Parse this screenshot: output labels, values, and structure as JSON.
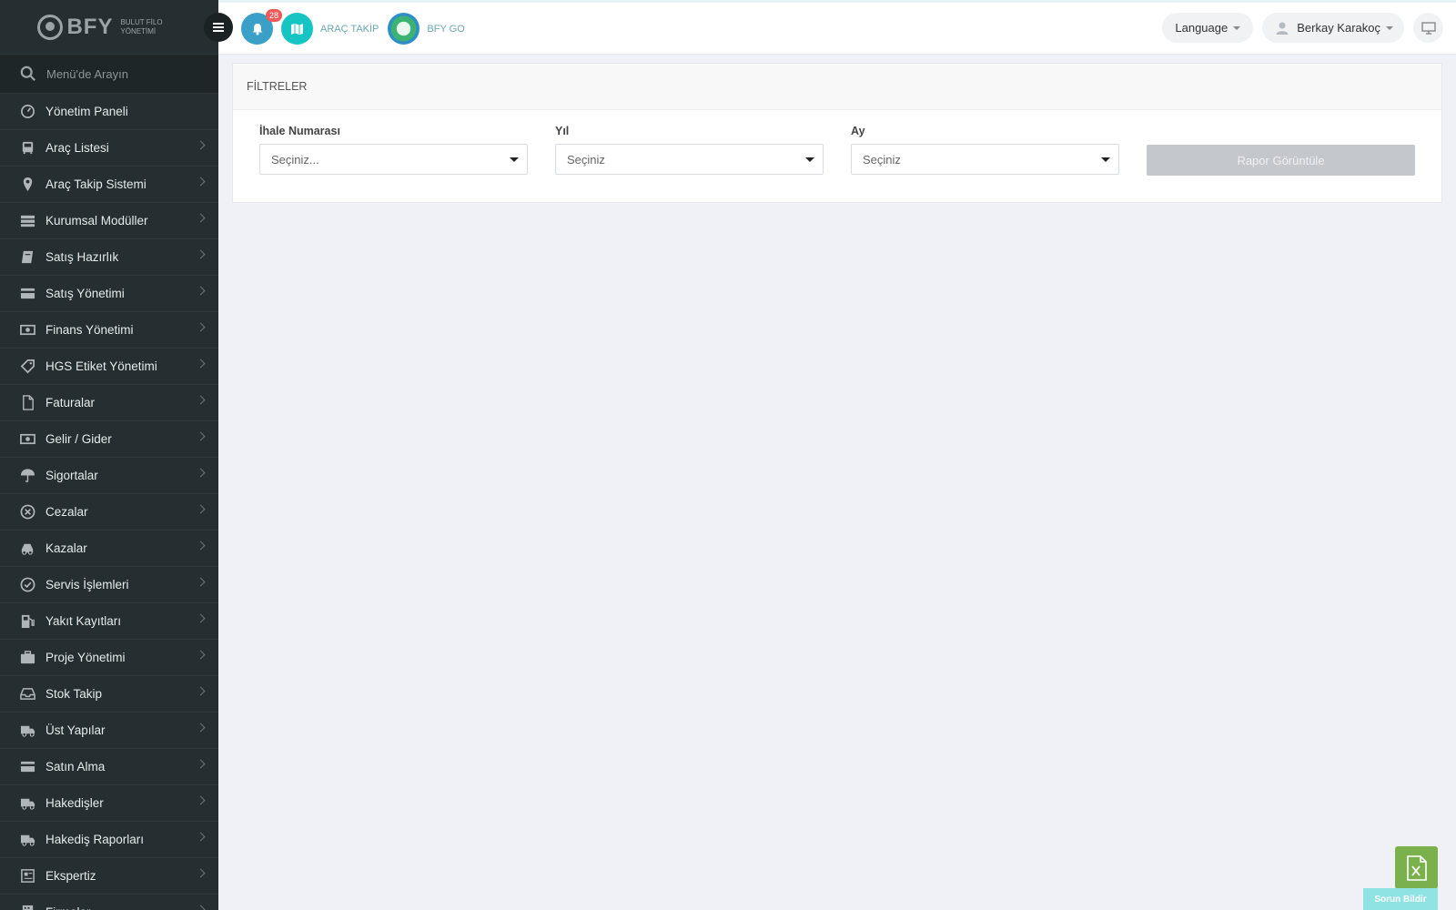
{
  "brand": {
    "name": "BFY",
    "sub_line1": "BULUT FİLO",
    "sub_line2": "YÖNETİMİ"
  },
  "sidebar": {
    "search_placeholder": "Menü'de Arayın",
    "items": [
      {
        "label": "Yönetim Paneli",
        "icon": "dashboard-icon"
      },
      {
        "label": "Araç Listesi",
        "icon": "bus-icon"
      },
      {
        "label": "Araç Takip Sistemi",
        "icon": "map-pin-icon"
      },
      {
        "label": "Kurumsal Modüller",
        "icon": "server-icon"
      },
      {
        "label": "Satış Hazırlık",
        "icon": "book-icon"
      },
      {
        "label": "Satış Yönetimi",
        "icon": "credit-card-icon"
      },
      {
        "label": "Finans Yönetimi",
        "icon": "money-icon"
      },
      {
        "label": "HGS Etiket Yönetimi",
        "icon": "tags-icon"
      },
      {
        "label": "Faturalar",
        "icon": "file-icon"
      },
      {
        "label": "Gelir / Gider",
        "icon": "money-icon"
      },
      {
        "label": "Sigortalar",
        "icon": "umbrella-icon"
      },
      {
        "label": "Cezalar",
        "icon": "times-circle-icon"
      },
      {
        "label": "Kazalar",
        "icon": "car-crash-icon"
      },
      {
        "label": "Servis İşlemleri",
        "icon": "check-circle-icon"
      },
      {
        "label": "Yakıt Kayıtları",
        "icon": "gas-pump-icon"
      },
      {
        "label": "Proje Yönetimi",
        "icon": "briefcase-icon"
      },
      {
        "label": "Stok Takip",
        "icon": "inbox-icon"
      },
      {
        "label": "Üst Yapılar",
        "icon": "truck-icon"
      },
      {
        "label": "Satın Alma",
        "icon": "credit-card-icon"
      },
      {
        "label": "Hakedişler",
        "icon": "truck-icon"
      },
      {
        "label": "Hakediş Raporları",
        "icon": "truck-icon"
      },
      {
        "label": "Ekspertiz",
        "icon": "newspaper-icon"
      },
      {
        "label": "Firmalar",
        "icon": "building-icon"
      }
    ]
  },
  "topbar": {
    "notification_count": "28",
    "arac_takip": "ARAÇ TAKİP",
    "bfy_go": "BFY GO",
    "language": "Language",
    "user_name": "Berkay Karakoç"
  },
  "filters": {
    "title": "FİLTRELER",
    "ihale_label": "İhale Numarası",
    "ihale_value": "Seçiniz...",
    "yil_label": "Yıl",
    "yil_value": "Seçiniz",
    "ay_label": "Ay",
    "ay_value": "Seçiniz",
    "report_button": "Rapor Görüntüle"
  },
  "floating": {
    "report_issue": "Sorun Bildir"
  },
  "colors": {
    "sidebar_bg": "#252e31",
    "accent_teal": "#17c4c4",
    "bell_blue": "#3aa0c8",
    "excel_green": "#7bb14d"
  }
}
